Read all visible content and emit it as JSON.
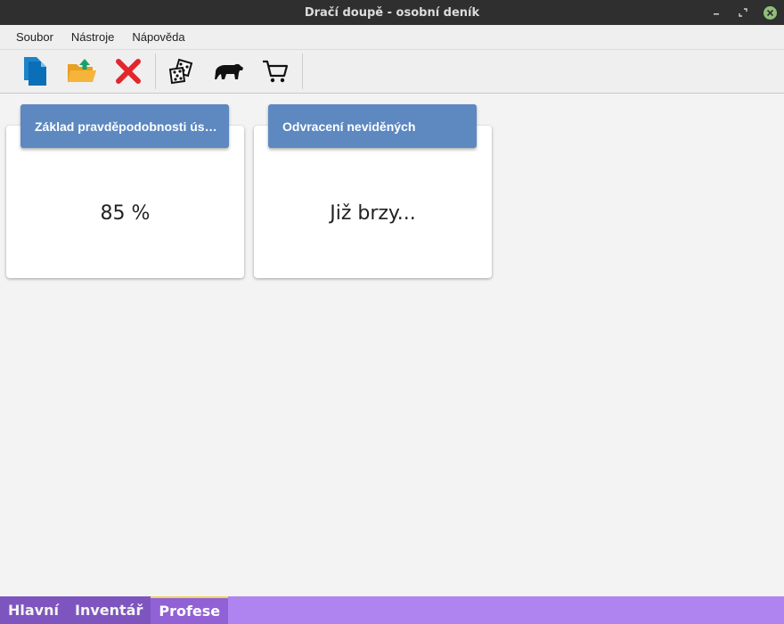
{
  "window": {
    "title": "Dračí doupě - osobní deník"
  },
  "menubar": {
    "items": [
      "Soubor",
      "Nástroje",
      "Nápověda"
    ]
  },
  "toolbar": {
    "buttons": [
      "new-document-icon",
      "open-folder-icon",
      "delete-x-icon",
      "dice-icon",
      "bear-icon",
      "shopping-cart-icon"
    ]
  },
  "cards": [
    {
      "title": "Základ pravděpodobnosti úsp...",
      "value": "85 %"
    },
    {
      "title": "Odvracení neviděných",
      "value": "Již brzy..."
    }
  ],
  "tabs": [
    {
      "label": "Hlavní",
      "active": false
    },
    {
      "label": "Inventář",
      "active": false
    },
    {
      "label": "Profese",
      "active": true
    }
  ],
  "colors": {
    "card_header": "#5d88c0",
    "tabbar": "#b084f0",
    "tab_active_indicator": "#f2d15a"
  }
}
